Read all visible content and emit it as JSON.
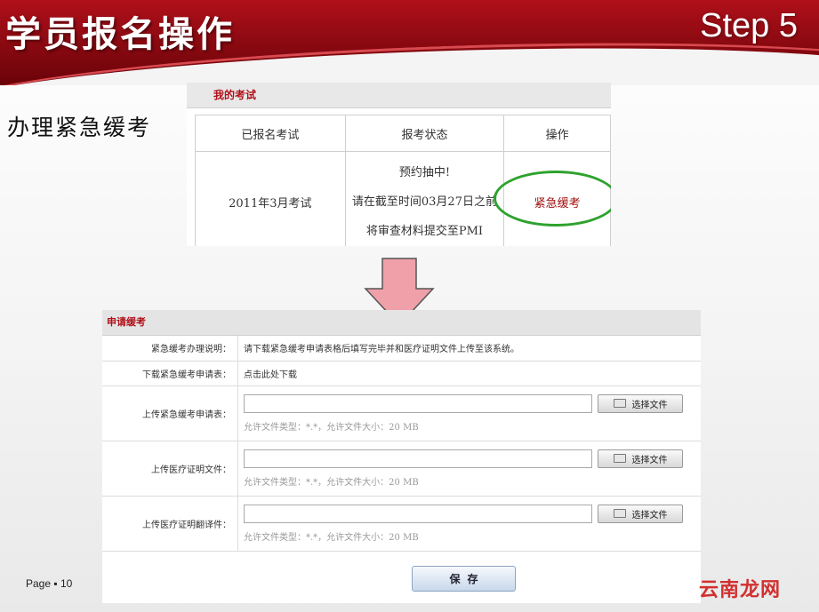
{
  "slide": {
    "title": "学员报名操作",
    "step": "Step 5",
    "subtitle": "办理紧急缓考",
    "page_label": "Page ▪ 10",
    "watermark": "云南龙网"
  },
  "exam_panel": {
    "title": "我的考试",
    "columns": [
      "已报名考试",
      "报考状态",
      "操作"
    ],
    "row": {
      "exam": "2011年3月考试",
      "status_lines": [
        "预约抽中!",
        "请在截至时间03月27日之前",
        "将审查材料提交至PMI"
      ],
      "action": "紧急缓考"
    },
    "highlight_color": "#2ea22e"
  },
  "form_panel": {
    "title": "申请缓考",
    "rows": [
      {
        "label": "紧急缓考办理说明：",
        "value": "请下载紧急缓考申请表格后填写完毕并和医疗证明文件上传至该系统。"
      },
      {
        "label": "下载紧急缓考申请表：",
        "value": "点击此处下载"
      }
    ],
    "uploads": [
      {
        "label": "上传紧急缓考申请表：",
        "button": "选择文件",
        "hint": "允许文件类型：*.*，允许文件大小：20 MB",
        "value": ""
      },
      {
        "label": "上传医疗证明文件：",
        "button": "选择文件",
        "hint": "允许文件类型：*.*，允许文件大小：20 MB",
        "value": ""
      },
      {
        "label": "上传医疗证明翻译件：",
        "button": "选择文件",
        "hint": "允许文件类型：*.*，允许文件大小：20 MB",
        "value": ""
      }
    ],
    "save_label": "保存"
  },
  "colors": {
    "brand_red": "#b0101a",
    "arrow_fill": "#f0a0a8",
    "arrow_stroke": "#555555"
  },
  "icons": [
    "down-arrow-icon",
    "file-icon"
  ]
}
